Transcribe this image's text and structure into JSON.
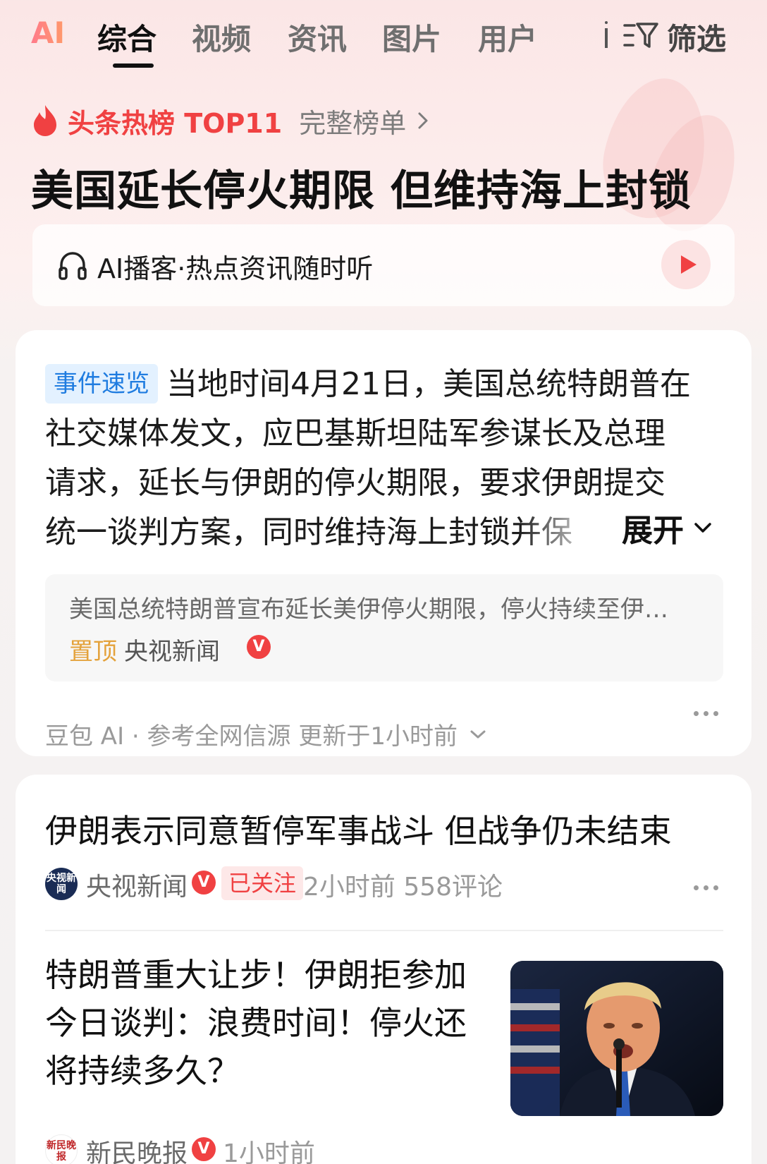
{
  "tabs": {
    "ai": "AI",
    "items": [
      "综合",
      "视频",
      "资讯",
      "图片",
      "用户"
    ],
    "filter": "筛选"
  },
  "hot": {
    "title": "头条热榜 TOP11",
    "link": "完整榜单",
    "headline": "美国延长停火期限 但维持海上封锁"
  },
  "podcast": {
    "text": "AI播客·热点资讯随时听"
  },
  "event_card": {
    "tag": "事件速览",
    "lines": [
      "当地时间4月21日，美国总统特朗普在",
      "社交媒体发文，应巴基斯坦陆军参谋长及总理",
      "请求，延长与伊朗的停火期限，要求伊朗提交",
      "统一谈判方案，同时维持海上封锁并保"
    ],
    "expand": "展开",
    "source_summary": "美国总统特朗普宣布延长美伊停火期限，停火持续至伊…",
    "pin_label": "置顶",
    "source_name": "央视新闻",
    "verified_mark": "V",
    "meta": "豆包 AI · 参考全网信源 更新于1小时前"
  },
  "articles": [
    {
      "title": "伊朗表示同意暂停军事战斗 但战争仍未结束",
      "avatar_text": "央视新闻",
      "source": "央视新闻",
      "follow": "已关注",
      "meta": "2小时前  558评论"
    },
    {
      "title": "特朗普重大让步！伊朗拒参加今日谈判：浪费时间！停火还将持续多久？",
      "avatar_text": "新民晚报",
      "source": "新民晚报",
      "meta": "1小时前"
    }
  ],
  "colors": {
    "accent_red": "#f04142",
    "tag_blue": "#1f7ce0",
    "pin_orange": "#e4a23b"
  }
}
